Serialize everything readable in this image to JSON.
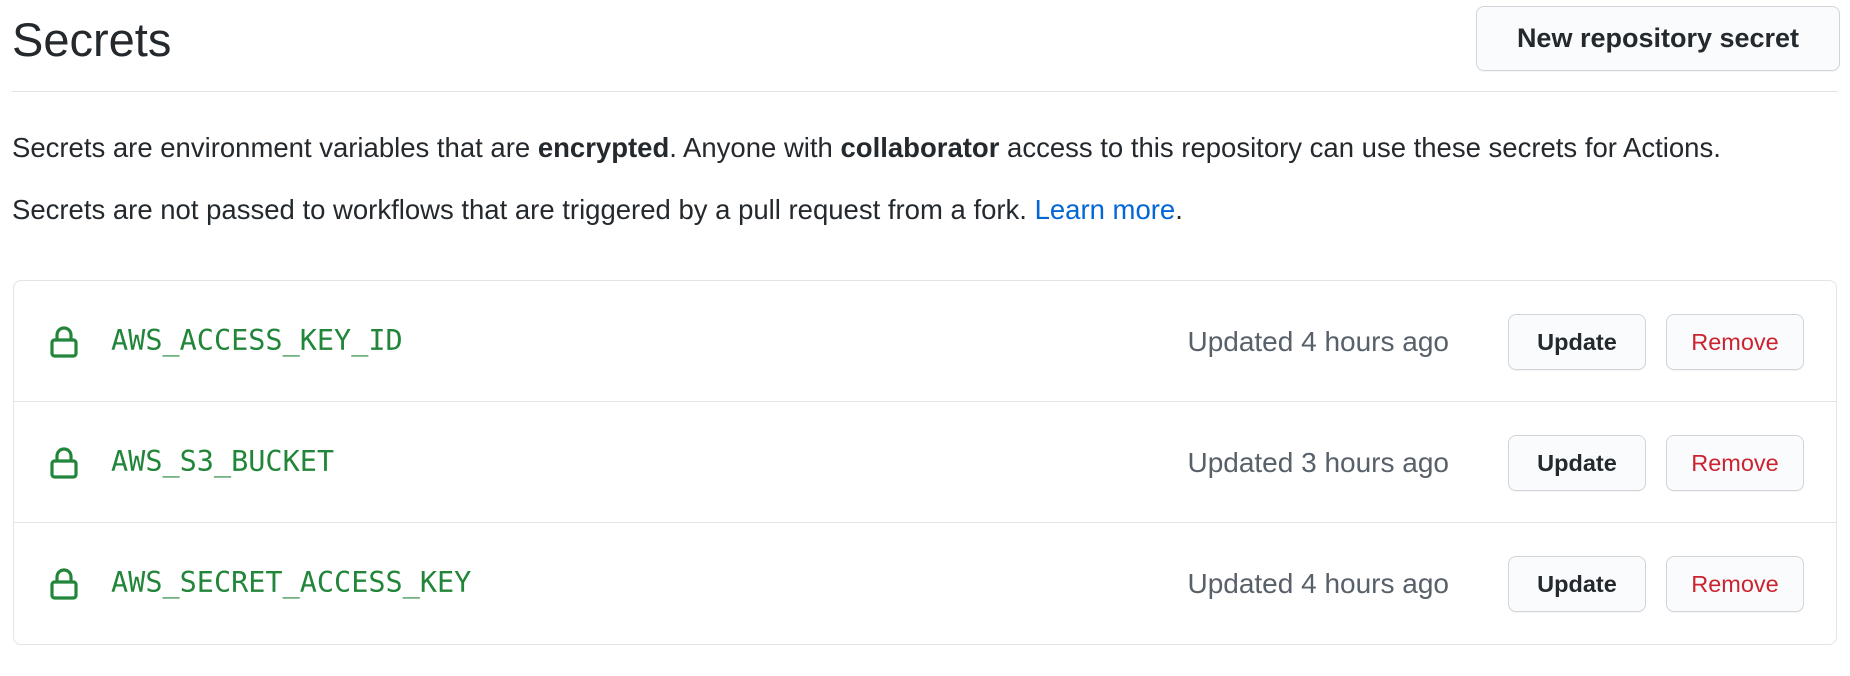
{
  "header": {
    "title": "Secrets",
    "new_secret_label": "New repository secret"
  },
  "description": {
    "line1_prefix": "Secrets are environment variables that are ",
    "line1_bold1": "encrypted",
    "line1_middle": ". Anyone with ",
    "line1_bold2": "collaborator",
    "line1_suffix": " access to this repository can use these secrets for Actions.",
    "line2_prefix": "Secrets are not passed to workflows that are triggered by a pull request from a fork. ",
    "line2_link": "Learn more",
    "line2_suffix": "."
  },
  "secrets": [
    {
      "name": "AWS_ACCESS_KEY_ID",
      "updated": "Updated 4 hours ago",
      "icon": "lock-icon",
      "update_label": "Update",
      "remove_label": "Remove"
    },
    {
      "name": "AWS_S3_BUCKET",
      "updated": "Updated 3 hours ago",
      "icon": "lock-icon",
      "update_label": "Update",
      "remove_label": "Remove"
    },
    {
      "name": "AWS_SECRET_ACCESS_KEY",
      "updated": "Updated 4 hours ago",
      "icon": "lock-icon",
      "update_label": "Update",
      "remove_label": "Remove"
    }
  ],
  "colors": {
    "secret_name": "#22863a",
    "link": "#0366d6",
    "danger": "#cb2431",
    "muted_text": "#586069",
    "border": "#e1e4e8"
  }
}
